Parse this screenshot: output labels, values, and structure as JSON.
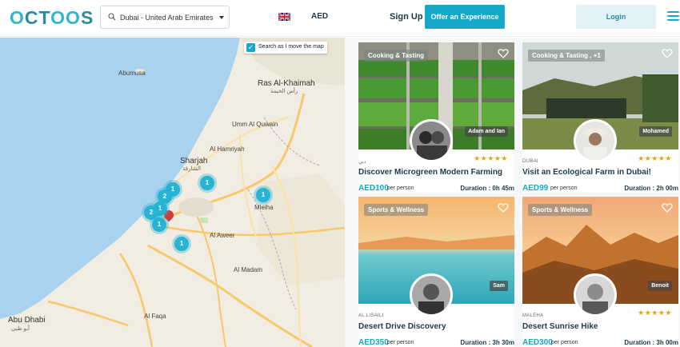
{
  "header": {
    "logo": "OCTOOS",
    "search_value": "Dubai - United Arab Emirates",
    "currency": "AED",
    "signup_label": "Sign Up",
    "offer_label": "Offer an Experience",
    "login_label": "Login",
    "icons": [
      "search-icon",
      "chevron-down-icon",
      "uk-flag-icon",
      "menu-icon"
    ],
    "accent_color": "#16a8c9"
  },
  "map": {
    "search_as_move_label": "Search as I move the map",
    "search_as_move_checked": true,
    "places": {
      "ras_al_khaimah": "Ras Al-Khaimah",
      "ras_al_khaimah_ar": "رأس الخيمة",
      "sharjah": "Sharjah",
      "sharjah_ar": "الشارقة",
      "al_awir": "Al Aweer",
      "al_madam": "Al Madam",
      "abu_dhabi": "Abu Dhabi",
      "abu_dhabi_ar": "أبو ظبي",
      "mleiha": "Mleiha",
      "umm_al_quwain": "Umm Al Quwain",
      "al_faqa": "Al Faqa",
      "al_hamriyah": "Al Hamriyah",
      "abumusa": "Abumusa"
    },
    "clusters": [
      "1",
      "1",
      "1",
      "2",
      "1",
      "2",
      "1",
      "1"
    ]
  },
  "listings": [
    {
      "category": "Cooking & Tasting",
      "host": "Adam and Ian",
      "location": "دبي",
      "title": "Discover Microgreen Modern Farming",
      "price": "AED100",
      "per": "per person",
      "duration": "Duration : 0h 45m",
      "stars": "★★★★★"
    },
    {
      "category": "Cooking & Tasting , +1",
      "host": "Mohamed",
      "location": "DUBAI",
      "title": "Visit an Ecological Farm in Dubai!",
      "price": "AED99",
      "per": "per person",
      "duration": "Duration : 2h 00m",
      "stars": "★★★★★"
    },
    {
      "category": "Sports & Wellness",
      "host": "Sam",
      "location": "AL LISAILI",
      "title": "Desert Drive Discovery",
      "price": "AED350",
      "per": "per person",
      "duration": "Duration : 3h 30m",
      "stars": ""
    },
    {
      "category": "Sports & Wellness",
      "host": "Benoit",
      "location": "MALEHA",
      "title": "Desert Sunrise Hike",
      "price": "AED300",
      "per": "per person",
      "duration": "Duration : 3h 00m",
      "stars": "★★★★★"
    }
  ]
}
